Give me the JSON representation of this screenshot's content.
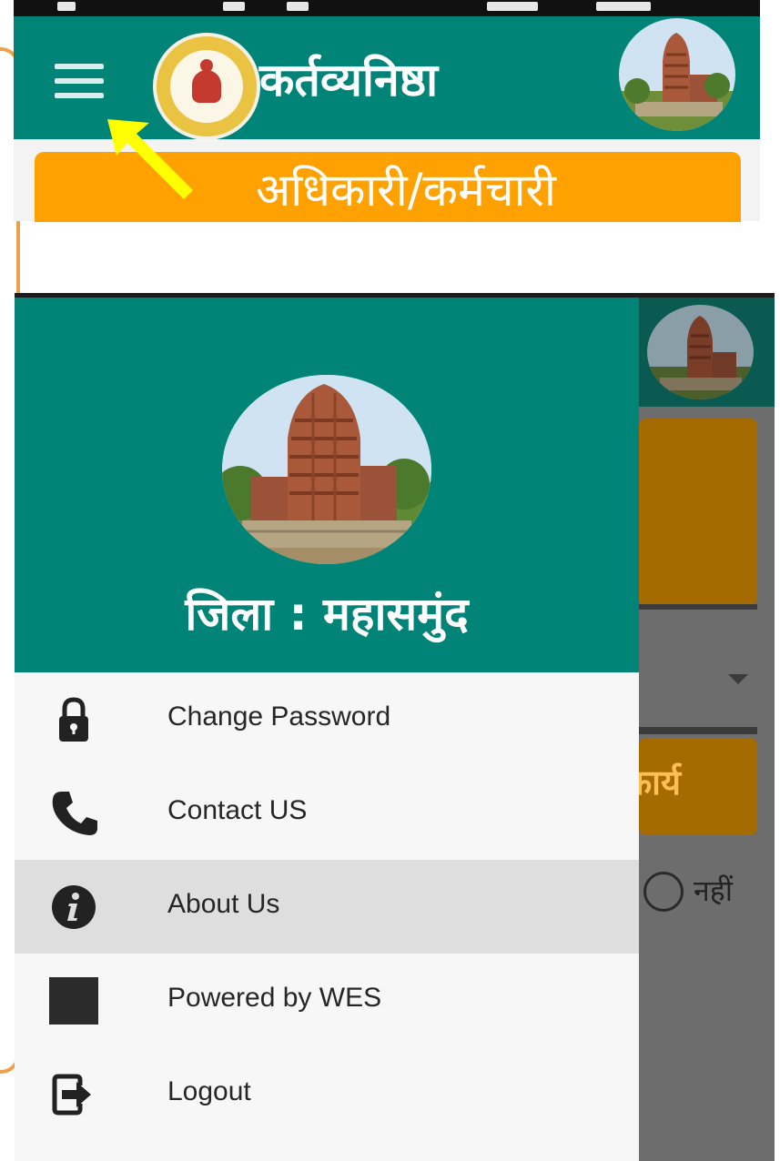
{
  "top_app": {
    "title": "कर्तव्यनिष्ठा",
    "role_label": "अधिकारी/कर्मचारी",
    "menu_icon": "hamburger-menu-icon",
    "logo_icon": "state-emblem-logo",
    "theme_color": "#008478",
    "role_color": "#ffa100"
  },
  "annotation": {
    "arrow_color": "#ffff00",
    "outline_color": "#f0a04b"
  },
  "drawer": {
    "header_color": "#008478",
    "district_label": "जिला : महासमुंद",
    "items": [
      {
        "label": "Change Password",
        "icon": "lock-icon"
      },
      {
        "label": "Contact US",
        "icon": "phone-icon"
      },
      {
        "label": "About Us",
        "icon": "info-icon",
        "active": true
      },
      {
        "label": "Powered by WES",
        "icon": "square-logo-icon"
      },
      {
        "label": "Logout",
        "icon": "logout-icon"
      }
    ]
  },
  "background_screen": {
    "button_label": "कार्य",
    "radio_label": "नहीं"
  }
}
